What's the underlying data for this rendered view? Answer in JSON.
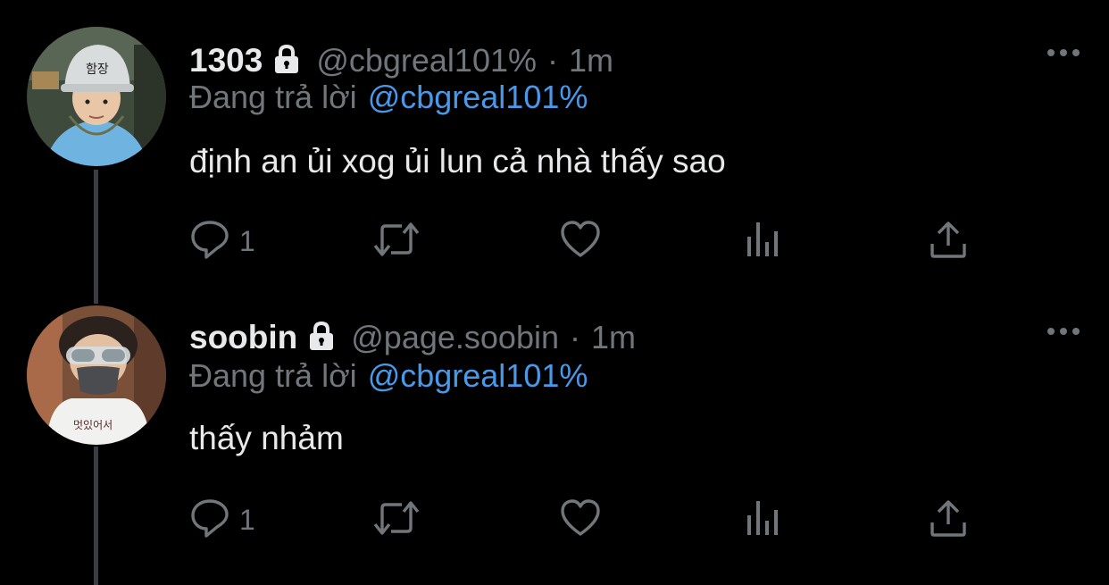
{
  "tweets": [
    {
      "display_name": "1303",
      "handle": "@cbgreal101%",
      "separator": "·",
      "time": "1m",
      "reply_prefix": "Đang trả lời",
      "reply_to": "@cbgreal101%",
      "text": "định an ủi xog ủi lun cả nhà thấy sao",
      "reply_count": "1",
      "avatar_sign_text": "함장"
    },
    {
      "display_name": "soobin",
      "handle": "@page.soobin",
      "separator": "·",
      "time": "1m",
      "reply_prefix": "Đang trả lời",
      "reply_to": "@cbgreal101%",
      "text": "thấy nhảm",
      "reply_count": "1",
      "avatar_sign_text": "멋있어서"
    }
  ],
  "icons": {
    "lock": "lock-icon",
    "more": "more-dots-icon",
    "reply": "reply-icon",
    "retweet": "retweet-icon",
    "like": "heart-icon",
    "analytics": "analytics-icon",
    "share": "share-icon"
  },
  "colors": {
    "background": "#000000",
    "text_primary": "#e7e9ea",
    "text_secondary": "#71767b",
    "link": "#4a99e9",
    "thread_line": "#3a3d41"
  }
}
